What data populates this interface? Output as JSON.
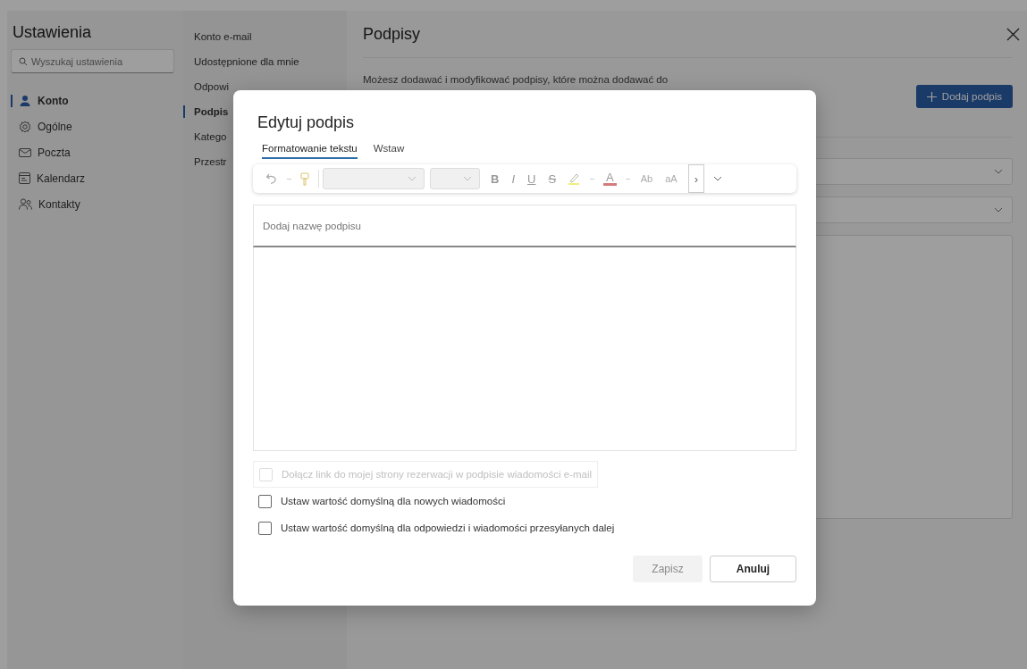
{
  "settings": {
    "title": "Ustawienia",
    "search": {
      "placeholder": "Wyszukaj ustawienia"
    },
    "nav": [
      {
        "label": "Konto",
        "selected": true
      },
      {
        "label": "Ogólne",
        "selected": false
      },
      {
        "label": "Poczta",
        "selected": false
      },
      {
        "label": "Kalendarz",
        "selected": false
      },
      {
        "label": "Kontakty",
        "selected": false
      }
    ],
    "subnav": [
      {
        "label": "Konto e-mail",
        "selected": false
      },
      {
        "label": "Udostępnione dla mnie",
        "selected": false
      },
      {
        "label": "Odpowi",
        "selected": false
      },
      {
        "label": "Podpis",
        "selected": true
      },
      {
        "label": "Katego",
        "selected": false
      },
      {
        "label": "Przestr",
        "selected": false
      }
    ]
  },
  "pane": {
    "title": "Podpisy",
    "description": "Możesz dodawać i modyfikować podpisy, które można dodawać do",
    "add_button": "Dodaj podpis"
  },
  "dialog": {
    "title": "Edytuj podpis",
    "tabs": [
      {
        "label": "Formatowanie tekstu",
        "selected": true
      },
      {
        "label": "Wstaw",
        "selected": false
      }
    ],
    "toolbar": {
      "letters": [
        "B",
        "I",
        "U",
        "S"
      ],
      "font_color": "A",
      "clear_format": "Ab",
      "case": "aA",
      "more": "›"
    },
    "name_field": {
      "placeholder": "Dodaj nazwę podpisu"
    },
    "checkboxes": [
      {
        "label": "Dołącz link do mojej strony rezerwacji w podpisie wiadomości e-mail",
        "checked": false,
        "disabled": true
      },
      {
        "label": "Ustaw wartość domyślną dla nowych wiadomości",
        "checked": false,
        "disabled": false
      },
      {
        "label": "Ustaw wartość domyślną dla odpowiedzi i wiadomości przesyłanych dalej",
        "checked": false,
        "disabled": false
      }
    ],
    "buttons": [
      {
        "label": "Zapisz",
        "disabled": true
      },
      {
        "label": "Anuluj",
        "disabled": false
      }
    ]
  }
}
